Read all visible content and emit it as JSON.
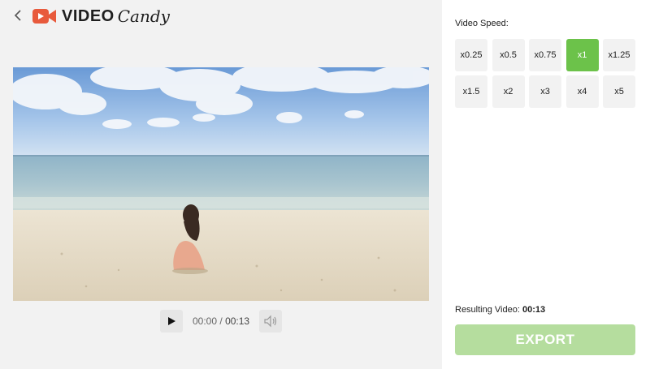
{
  "header": {
    "logo_primary": "VIDEO",
    "logo_secondary": "Candy",
    "brand_color": "#e85a3c"
  },
  "player": {
    "current_time": "00:00",
    "separator": "/",
    "duration": "00:13"
  },
  "speed_panel": {
    "label": "Video Speed:",
    "options": [
      "x0.25",
      "x0.5",
      "x0.75",
      "x1",
      "x1.25",
      "x1.5",
      "x2",
      "x3",
      "x4",
      "x5"
    ],
    "selected": "x1",
    "accent_color": "#6cc24a"
  },
  "result": {
    "label": "Resulting Video:",
    "value": "00:13"
  },
  "export": {
    "label": "EXPORT",
    "color": "#b5dd9e"
  },
  "icons": [
    "back-icon",
    "logo-camera-icon",
    "play-icon",
    "volume-icon"
  ]
}
